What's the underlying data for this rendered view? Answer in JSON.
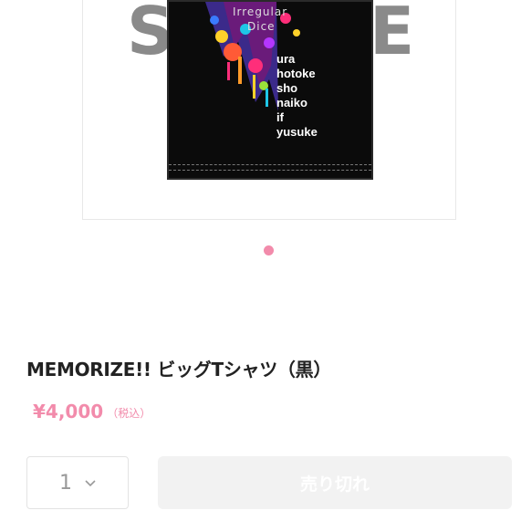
{
  "product": {
    "image": {
      "watermark_left": "S",
      "watermark_right": "E",
      "logo_top": "Irregular",
      "logo_sub": "Dice",
      "shirt_names": [
        "ura",
        "hotoke",
        "sho",
        "naiko",
        "if",
        "yusuke"
      ]
    },
    "carousel": {
      "active_index": 1,
      "dot_color": "#f28bab"
    },
    "title": "MEMORIZE!! ビッグTシャツ（黒）",
    "price": "¥4,000",
    "price_tax_note": "（税込）",
    "quantity": "1",
    "soldout_label": "売り切れ",
    "colors": {
      "accent": "#f28bab",
      "button_bg": "#f2f2f2",
      "title": "#222222"
    }
  }
}
